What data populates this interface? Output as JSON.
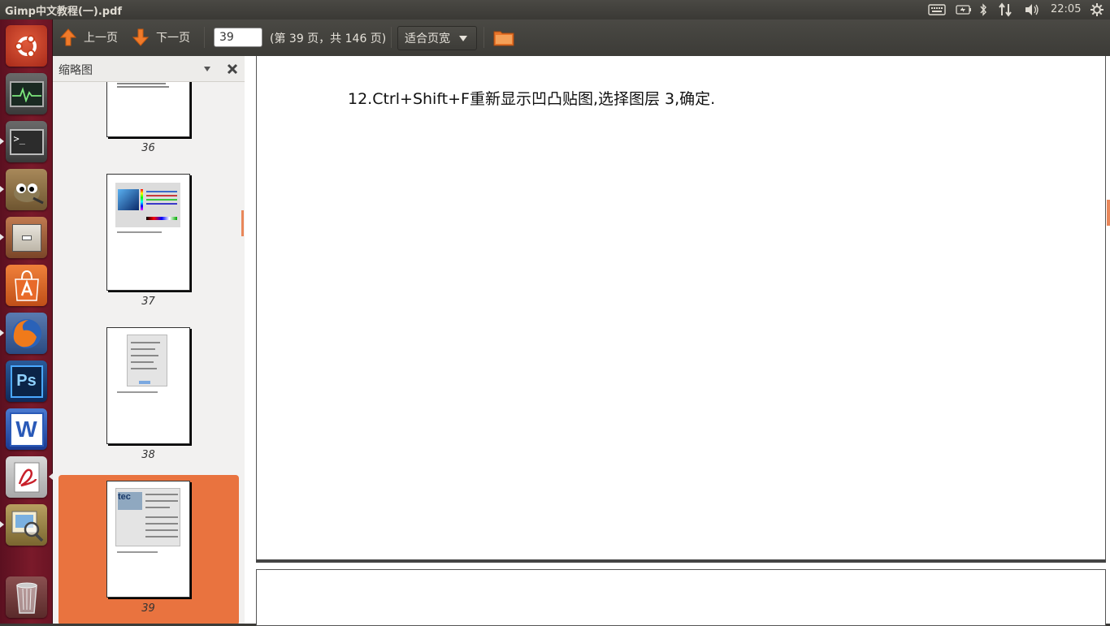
{
  "window": {
    "title": "Gimp中文教程(一).pdf"
  },
  "panel": {
    "clock": "22:05"
  },
  "toolbar": {
    "prev_label": "上一页",
    "next_label": "下一页",
    "page_value": "39",
    "page_count": "(第 39 页，共 146 页)",
    "zoom_label": "适合页宽"
  },
  "sidebar": {
    "title": "缩略图",
    "thumbnails": [
      {
        "page": "36"
      },
      {
        "page": "37"
      },
      {
        "page": "38"
      },
      {
        "page": "39",
        "selected": true
      }
    ]
  },
  "document": {
    "text": "12.Ctrl+Shift+F重新显示凹凸贴图,选择图层 3,确定."
  },
  "launcher": {
    "items": [
      "ubuntu-home",
      "system-monitor",
      "terminal",
      "gimp",
      "file-manager",
      "software-center",
      "firefox",
      "photoshop",
      "wps-writer",
      "pdf-reader",
      "image-viewer",
      "trash"
    ]
  },
  "colors": {
    "accent": "#e9733f",
    "launcher": "#7a1a2a",
    "panel": "#3c3b37"
  }
}
